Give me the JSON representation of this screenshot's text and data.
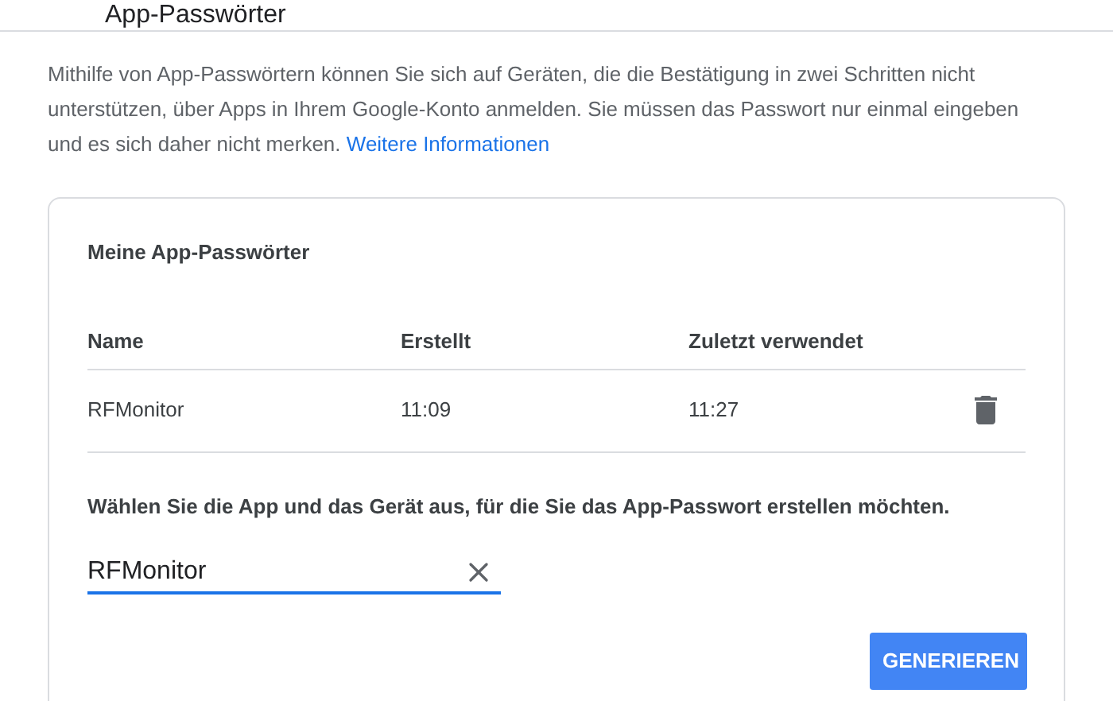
{
  "header": {
    "title": "App-Passwörter"
  },
  "intro": {
    "text": "Mithilfe von App-Passwörtern können Sie sich auf Geräten, die die Bestätigung in zwei Schritten nicht unterstützen, über Apps in Ihrem Google-Konto anmelden. Sie müssen das Passwort nur einmal eingeben und es sich daher nicht merken.",
    "link": "Weitere Informationen"
  },
  "card": {
    "title": "Meine App-Passwörter",
    "table": {
      "columns": [
        "Name",
        "Erstellt",
        "Zuletzt verwendet"
      ],
      "rows": [
        {
          "name": "RFMonitor",
          "created": "11:09",
          "last_used": "11:27"
        }
      ]
    },
    "prompt": "Wählen Sie die App und das Gerät aus, für die Sie das App-Passwort erstellen möchten.",
    "field": {
      "value": "RFMonitor"
    },
    "button": "GENERIEREN"
  }
}
